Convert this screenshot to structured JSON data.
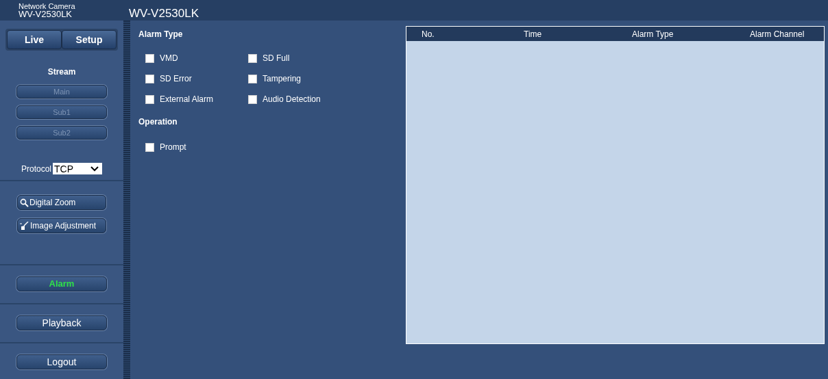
{
  "header": {
    "brand_line1": "Network Camera",
    "brand_line2": "WV-V2530LK",
    "title": "WV-V2530LK"
  },
  "top_buttons": [
    "Live",
    "Setup"
  ],
  "stream": {
    "title": "Stream",
    "buttons": [
      {
        "label": "Main",
        "disabled": true
      },
      {
        "label": "Sub1",
        "disabled": true
      },
      {
        "label": "Sub2",
        "disabled": true
      }
    ],
    "protocol_label": "Protocol",
    "protocol_value": "TCP"
  },
  "tools": [
    {
      "label": "Digital Zoom",
      "kind": "zoom"
    },
    {
      "label": "Image Adjustment",
      "kind": "adjust"
    }
  ],
  "nav": [
    {
      "label": "Alarm",
      "selected": true
    },
    {
      "label": "Playback",
      "selected": false
    },
    {
      "label": "Logout",
      "selected": false
    }
  ],
  "alarm_type": {
    "title": "Alarm Type",
    "options": [
      {
        "label": "VMD",
        "checked": false
      },
      {
        "label": "SD Full",
        "checked": false
      },
      {
        "label": "SD Error",
        "checked": false
      },
      {
        "label": "Tampering",
        "checked": false
      },
      {
        "label": "External Alarm",
        "checked": false
      },
      {
        "label": "Audio Detection",
        "checked": false
      }
    ]
  },
  "operation": {
    "title": "Operation",
    "options": [
      {
        "label": "Prompt",
        "checked": false
      }
    ]
  },
  "table": {
    "columns": [
      "No.",
      "Time",
      "Alarm Type",
      "Alarm Channel"
    ]
  }
}
